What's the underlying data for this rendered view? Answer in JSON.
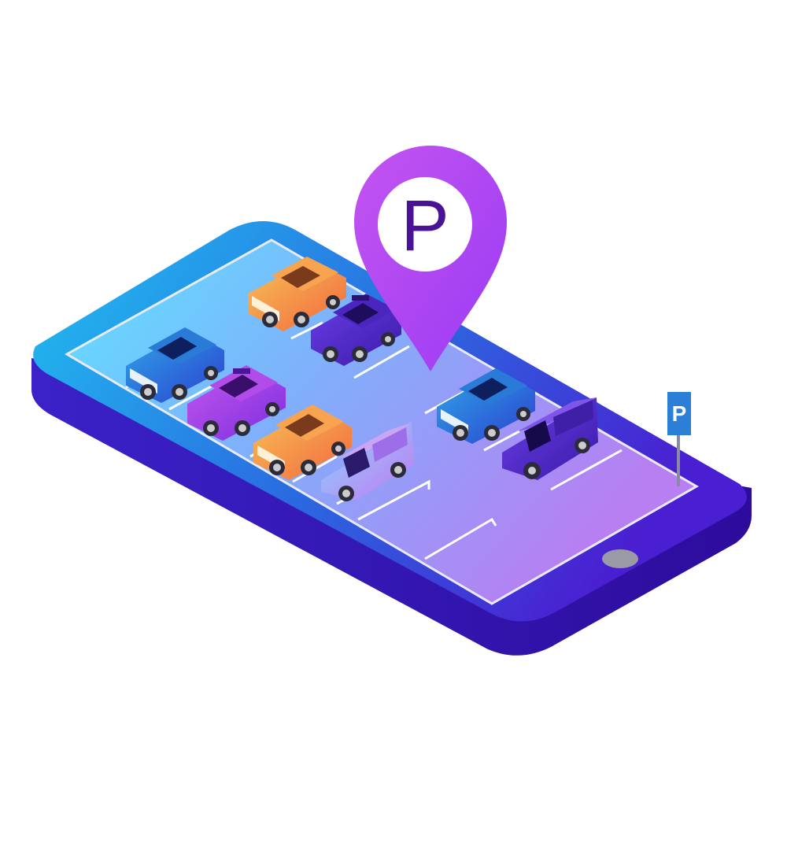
{
  "illustration": {
    "pin_letter": "P",
    "sign_letter": "P",
    "icons": [
      "location-pin-icon",
      "parking-sign-icon",
      "home-button-icon"
    ],
    "vehicles": [
      {
        "id": "orange-car-top",
        "kind": "sedan",
        "color": "#f28a4d"
      },
      {
        "id": "purple-taxi-top",
        "kind": "taxi",
        "color": "#5a2fd0"
      },
      {
        "id": "blue-car-left",
        "kind": "sedan",
        "color": "#2c5fe0"
      },
      {
        "id": "purple-taxi-left",
        "kind": "taxi",
        "color": "#9b3ff0"
      },
      {
        "id": "orange-car-middle",
        "kind": "sedan",
        "color": "#f28a4d"
      },
      {
        "id": "lilac-van",
        "kind": "van",
        "color": "#b390f5"
      },
      {
        "id": "blue-car-right",
        "kind": "sedan",
        "color": "#2a6be0"
      },
      {
        "id": "purple-van-right",
        "kind": "van",
        "color": "#5b2cc8"
      }
    ],
    "colors": {
      "phone_edge": "#3b10a8",
      "phone_top_start": "#1fb8ec",
      "phone_top_end": "#4a1fd1",
      "screen_start": "#66e0ff",
      "screen_end": "#b07cf2",
      "pin": "#b04cf2",
      "pin_letter": "#4a1296",
      "sign_plate": "#2b7fd6",
      "home_button": "#9a9aa6"
    }
  }
}
